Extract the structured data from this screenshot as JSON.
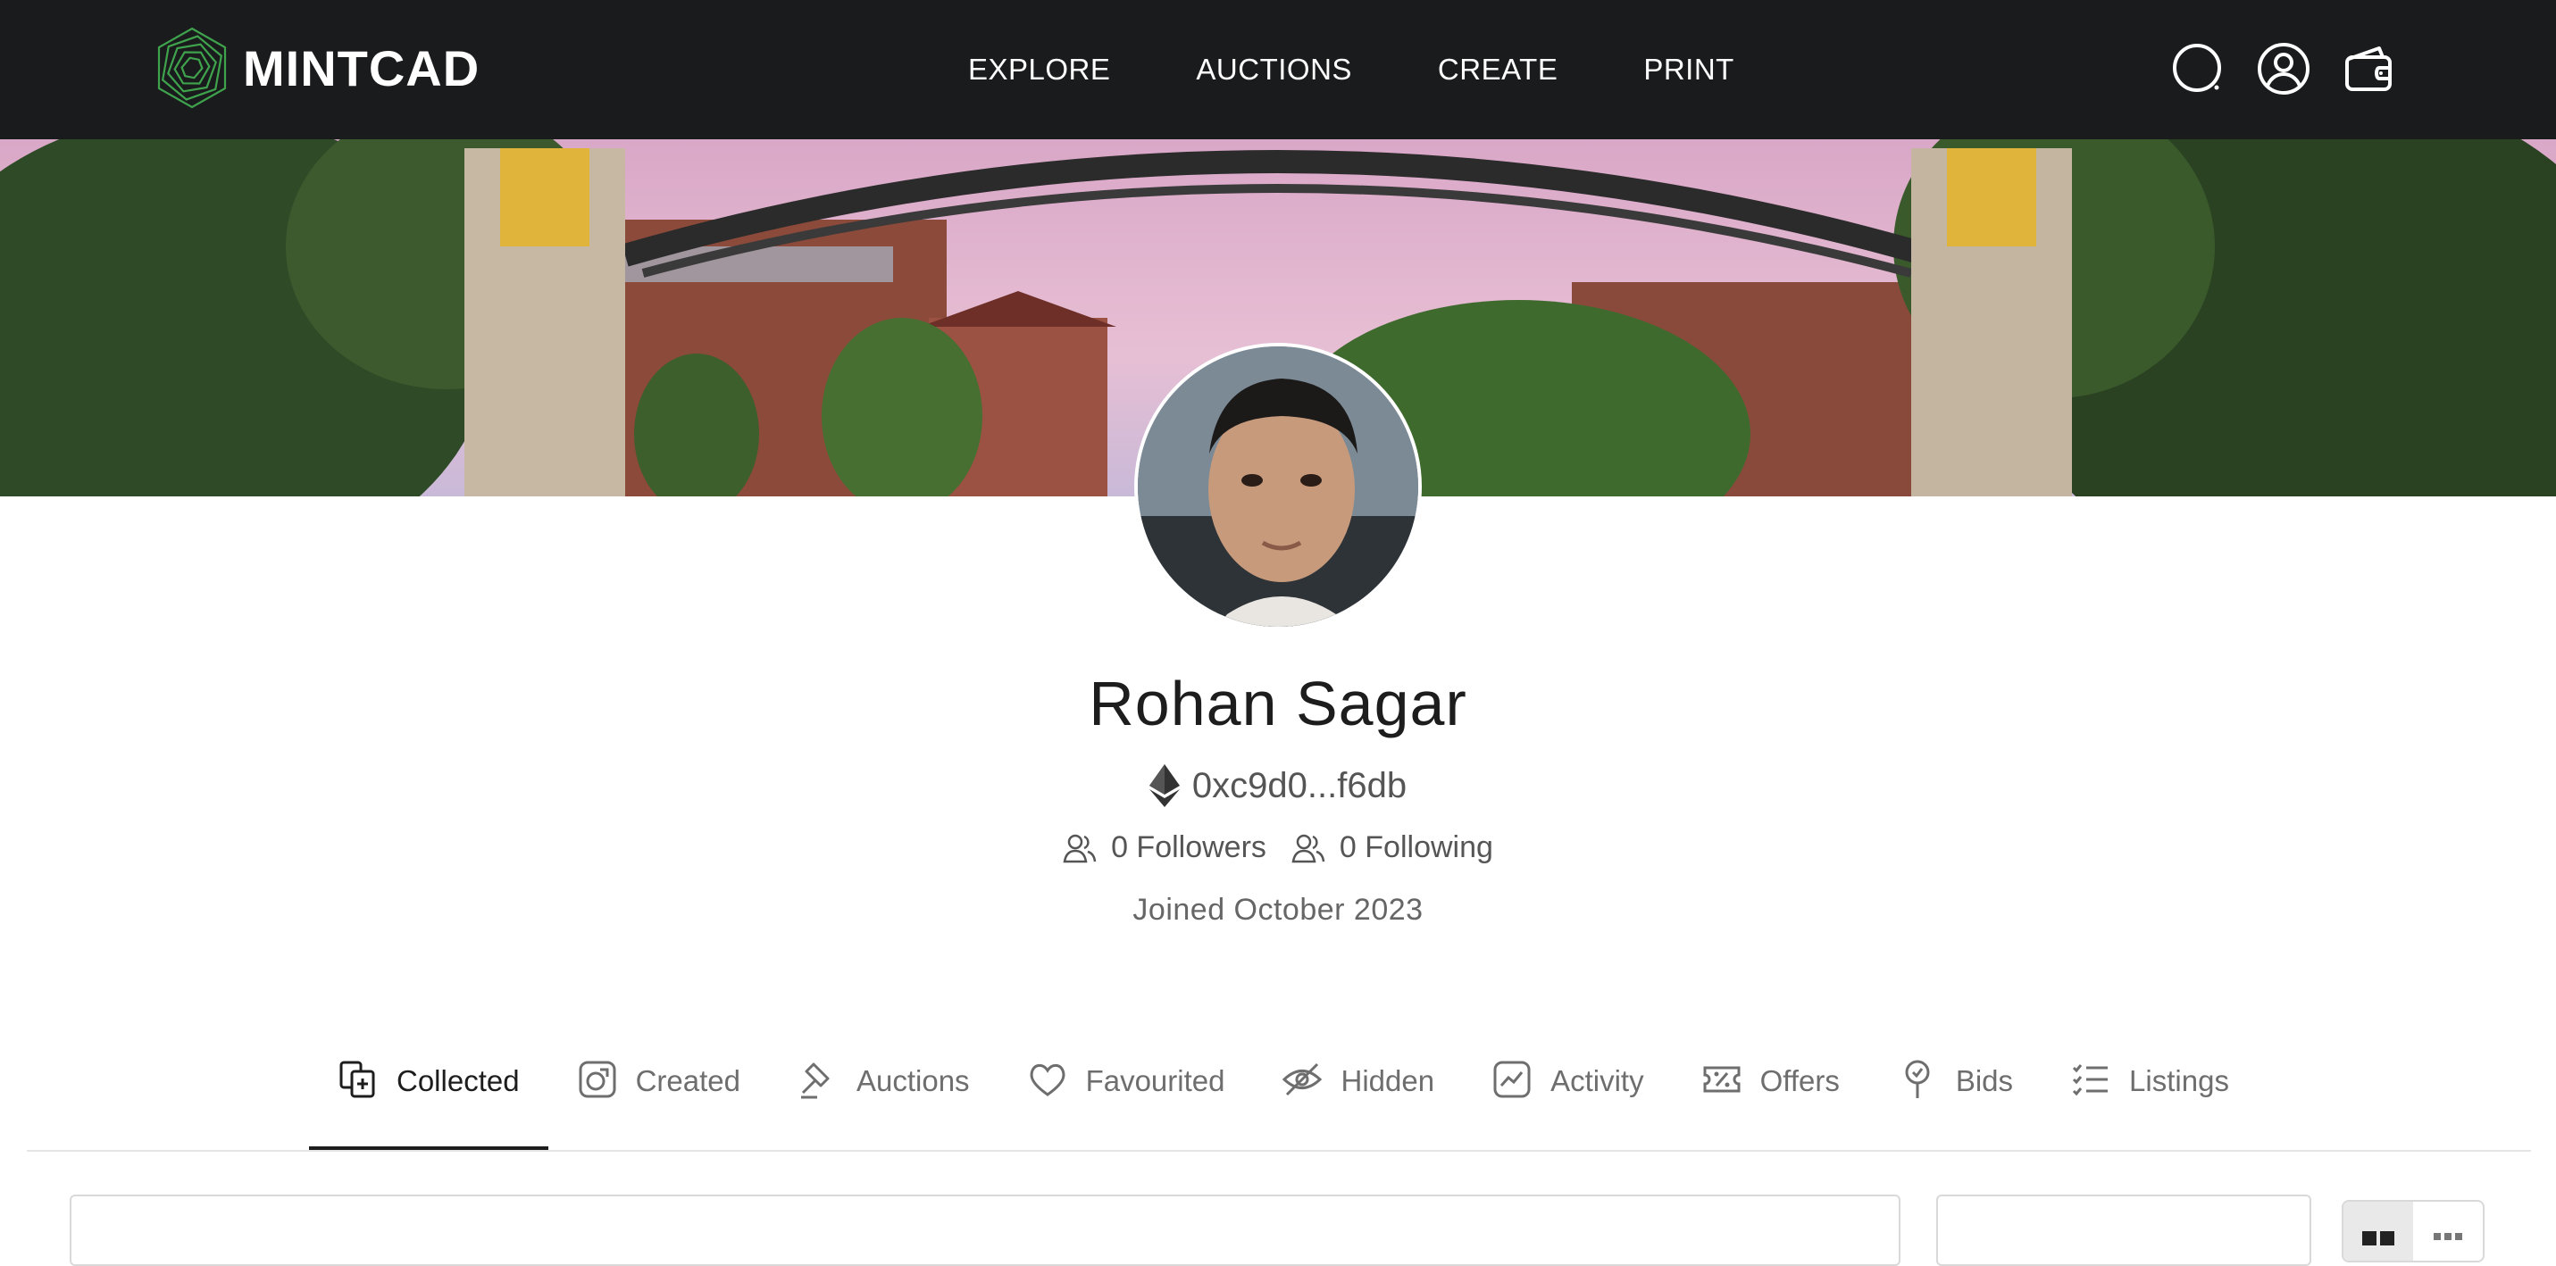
{
  "brand": {
    "name": "MINTCAD",
    "accent": "#3fa34d"
  },
  "nav": {
    "items": [
      {
        "label": "EXPLORE"
      },
      {
        "label": "AUCTIONS"
      },
      {
        "label": "CREATE"
      },
      {
        "label": "PRINT"
      }
    ],
    "icons": [
      "search-icon",
      "user-icon",
      "wallet-icon"
    ]
  },
  "profile": {
    "name": "Rohan Sagar",
    "wallet_address": "0xc9d0...f6db",
    "followers": "0 Followers",
    "following": "0 Following",
    "joined": "Joined October 2023"
  },
  "tabs": [
    {
      "label": "Collected",
      "icon": "collected-icon",
      "active": true
    },
    {
      "label": "Created",
      "icon": "created-icon"
    },
    {
      "label": "Auctions",
      "icon": "gavel-icon"
    },
    {
      "label": "Favourited",
      "icon": "heart-icon"
    },
    {
      "label": "Hidden",
      "icon": "eye-off-icon"
    },
    {
      "label": "Activity",
      "icon": "activity-icon"
    },
    {
      "label": "Offers",
      "icon": "offers-icon"
    },
    {
      "label": "Bids",
      "icon": "bids-icon"
    },
    {
      "label": "Listings",
      "icon": "listings-icon"
    }
  ]
}
